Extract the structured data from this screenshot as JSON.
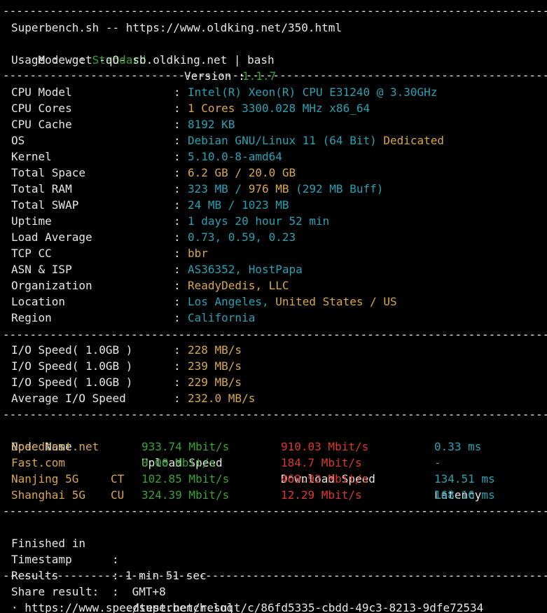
{
  "separator": "-----------------------------------------------------------------------------------------------------------",
  "header": {
    "title": "Superbench.sh -- https://www.oldking.net/350.html",
    "mode_label": "Mode  : ",
    "mode_value": "Standard",
    "version_label": "Version : ",
    "version_value": "1.1.7",
    "usage": "Usage : wget -qO- sb.oldking.net | bash"
  },
  "system": [
    {
      "label": "CPU Model",
      "value": "Intel(R) Xeon(R) CPU E31240 @ 3.30GHz",
      "color": "#2aa1b3"
    },
    {
      "label": "CPU Cores",
      "value": "1 Cores",
      "color": "#d7a74a",
      "extra": " 3300.028 MHz x86_64",
      "extra_color": "#2aa1b3"
    },
    {
      "label": "CPU Cache",
      "value": "8192 KB",
      "color": "#2aa1b3"
    },
    {
      "label": "OS",
      "value": "Debian GNU/Linux 11 (64 Bit)",
      "color": "#2aa1b3",
      "extra": " Dedicated",
      "extra_color": "#d7a74a"
    },
    {
      "label": "Kernel",
      "value": "5.10.0-8-amd64",
      "color": "#2aa1b3"
    },
    {
      "label": "Total Space",
      "value": "6.2 GB / ",
      "color": "#d7a74a",
      "extra": "20.0 GB",
      "extra_color": "#d7a74a"
    },
    {
      "label": "Total RAM",
      "value": "323 MB / ",
      "color": "#2aa1b3",
      "extra": "976 MB",
      "extra_color": "#d7a74a",
      "extra2": " (292 MB Buff)",
      "extra2_color": "#2aa1b3"
    },
    {
      "label": "Total SWAP",
      "value": "24 MB / 1023 MB",
      "color": "#2aa1b3"
    },
    {
      "label": "Uptime",
      "value": "1 days 20 hour 52 min",
      "color": "#2aa1b3"
    },
    {
      "label": "Load Average",
      "value": "0.73, 0.59, 0.23",
      "color": "#2aa1b3"
    },
    {
      "label": "TCP CC",
      "value": "bbr",
      "color": "#d7a74a"
    },
    {
      "label": "ASN & ISP",
      "value": "AS36352, HostPapa",
      "color": "#2aa1b3"
    },
    {
      "label": "Organization",
      "value": "ReadyDedis, LLC",
      "color": "#d7a74a"
    },
    {
      "label": "Location",
      "value": "Los Angeles, ",
      "color": "#2aa1b3",
      "extra": "United States / US",
      "extra_color": "#d7a74a"
    },
    {
      "label": "Region",
      "value": "California",
      "color": "#2aa1b3"
    }
  ],
  "io": [
    {
      "label": "I/O Speed( 1.0GB )",
      "value": "228 MB/s"
    },
    {
      "label": "I/O Speed( 1.0GB )",
      "value": "239 MB/s"
    },
    {
      "label": "I/O Speed( 1.0GB )",
      "value": "229 MB/s"
    },
    {
      "label": "Average I/O Speed",
      "value": "232.0 MB/s"
    }
  ],
  "speed": {
    "headers": [
      "Node Name",
      "Upload Speed",
      "Download Speed",
      "Latency"
    ],
    "rows": [
      {
        "node": "Speedtest.net",
        "isp": "",
        "upload": "933.74 Mbit/s",
        "download": "910.03 Mbit/s",
        "latency": "0.33 ms"
      },
      {
        "node": "Fast.com",
        "isp": "",
        "upload": "0.00 Mbit/s",
        "download": "184.7 Mbit/s",
        "latency": "-"
      },
      {
        "node": "Nanjing 5G",
        "isp": "CT",
        "upload": "102.85 Mbit/s",
        "download": "469.92 Mbit/s",
        "latency": "134.51 ms"
      },
      {
        "node": "Shanghai 5G",
        "isp": "CU",
        "upload": "324.39 Mbit/s",
        "download": "12.29 Mbit/s",
        "latency": "168.16 ms"
      }
    ]
  },
  "footer": {
    "finished_label": "Finished in",
    "finished_value": "1 min 51 sec",
    "timestamp_label": "Timestamp",
    "timestamp_value": " GMT+8",
    "results_label": "Results",
    "results_value": "./superbench.log",
    "share_label": "Share result:",
    "share_link": "· https://www.speedtest.net/result/c/86fd5335-cbdd-49c3-8213-9dfe72534"
  }
}
